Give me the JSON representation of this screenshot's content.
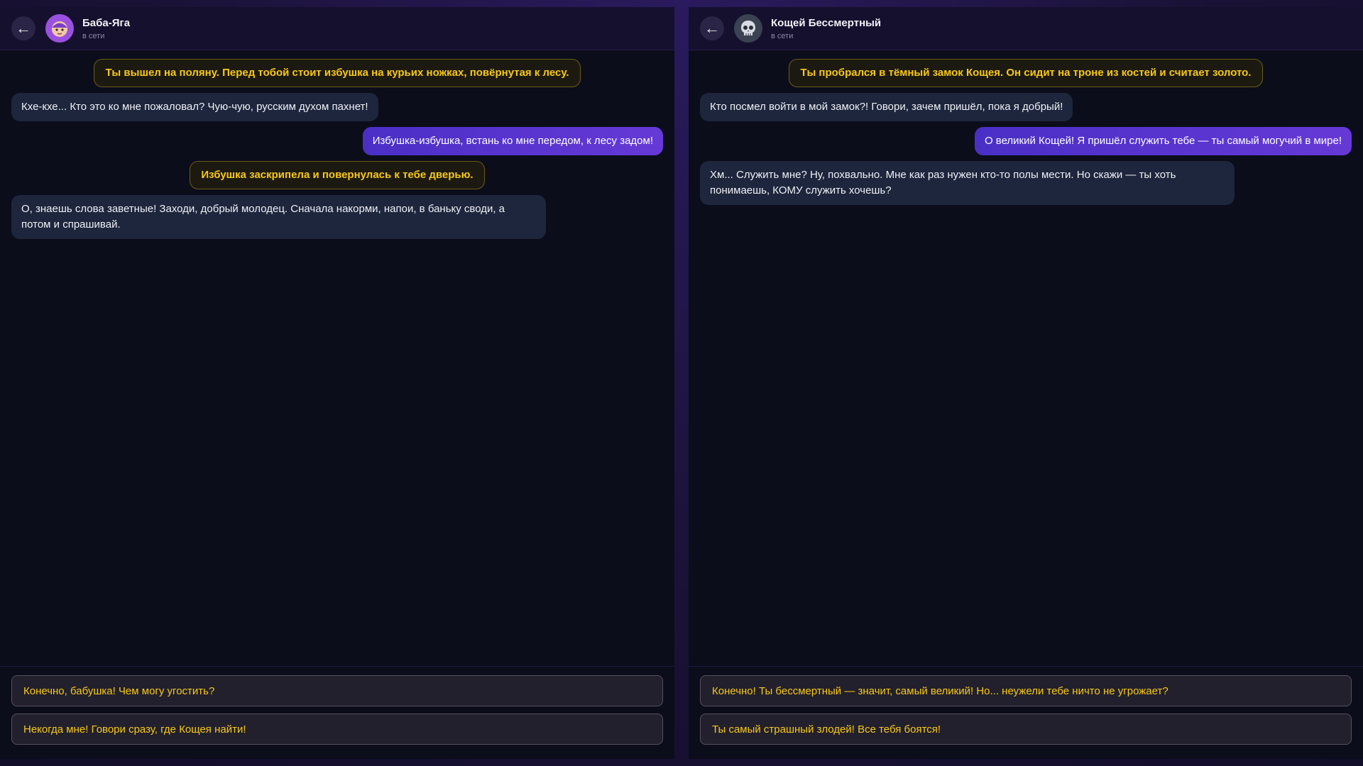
{
  "chats": [
    {
      "name": "Баба-Яга",
      "status": "в сети",
      "avatar_icon": "baba-yaga-face-icon",
      "messages": [
        {
          "type": "narration",
          "text": "Ты вышел на поляну. Перед тобой стоит избушка на курьих ножках, повёрнутая к лесу."
        },
        {
          "type": "npc",
          "text": "Кхе-кхе... Кто это ко мне пожаловал? Чую-чую, русским духом пахнет!"
        },
        {
          "type": "player",
          "text": "Избушка-избушка, встань ко мне передом, к лесу задом!"
        },
        {
          "type": "narration",
          "text": "Избушка заскрипела и повернулась к тебе дверью."
        },
        {
          "type": "npc",
          "text": "О, знаешь слова заветные! Заходи, добрый молодец. Сначала накорми, напои, в баньку своди, а потом и спрашивай."
        }
      ],
      "choices": [
        "Конечно, бабушка! Чем могу угостить?",
        "Некогда мне! Говори сразу, где Кощея найти!"
      ]
    },
    {
      "name": "Кощей Бессмертный",
      "status": "в сети",
      "avatar_icon": "skull-icon",
      "messages": [
        {
          "type": "narration",
          "text": "Ты пробрался в тёмный замок Кощея. Он сидит на троне из костей и считает золото."
        },
        {
          "type": "npc",
          "text": "Кто посмел войти в мой замок?! Говори, зачем пришёл, пока я добрый!"
        },
        {
          "type": "player",
          "text": "О великий Кощей! Я пришёл служить тебе — ты самый могучий в мире!"
        },
        {
          "type": "npc",
          "text": "Хм... Служить мне? Ну, похвально. Мне как раз нужен кто-то полы мести. Но скажи — ты хоть понимаешь, КОМУ служить хочешь?"
        }
      ],
      "choices": [
        "Конечно! Ты бессмертный — значит, самый великий! Но... неужели тебе ничто не угрожает?",
        "Ты самый страшный злодей! Все тебя боятся!"
      ]
    }
  ],
  "back_icon": "←",
  "colors": {
    "narration_text": "#f7c81c",
    "player_bubble": "#5a34d0",
    "npc_bubble": "#1e263d",
    "panel_bg": "#0b0d1a",
    "header_bg": "#15102e",
    "yaga_avatar": "#9b51e0",
    "koschei_avatar": "#3b4252"
  }
}
